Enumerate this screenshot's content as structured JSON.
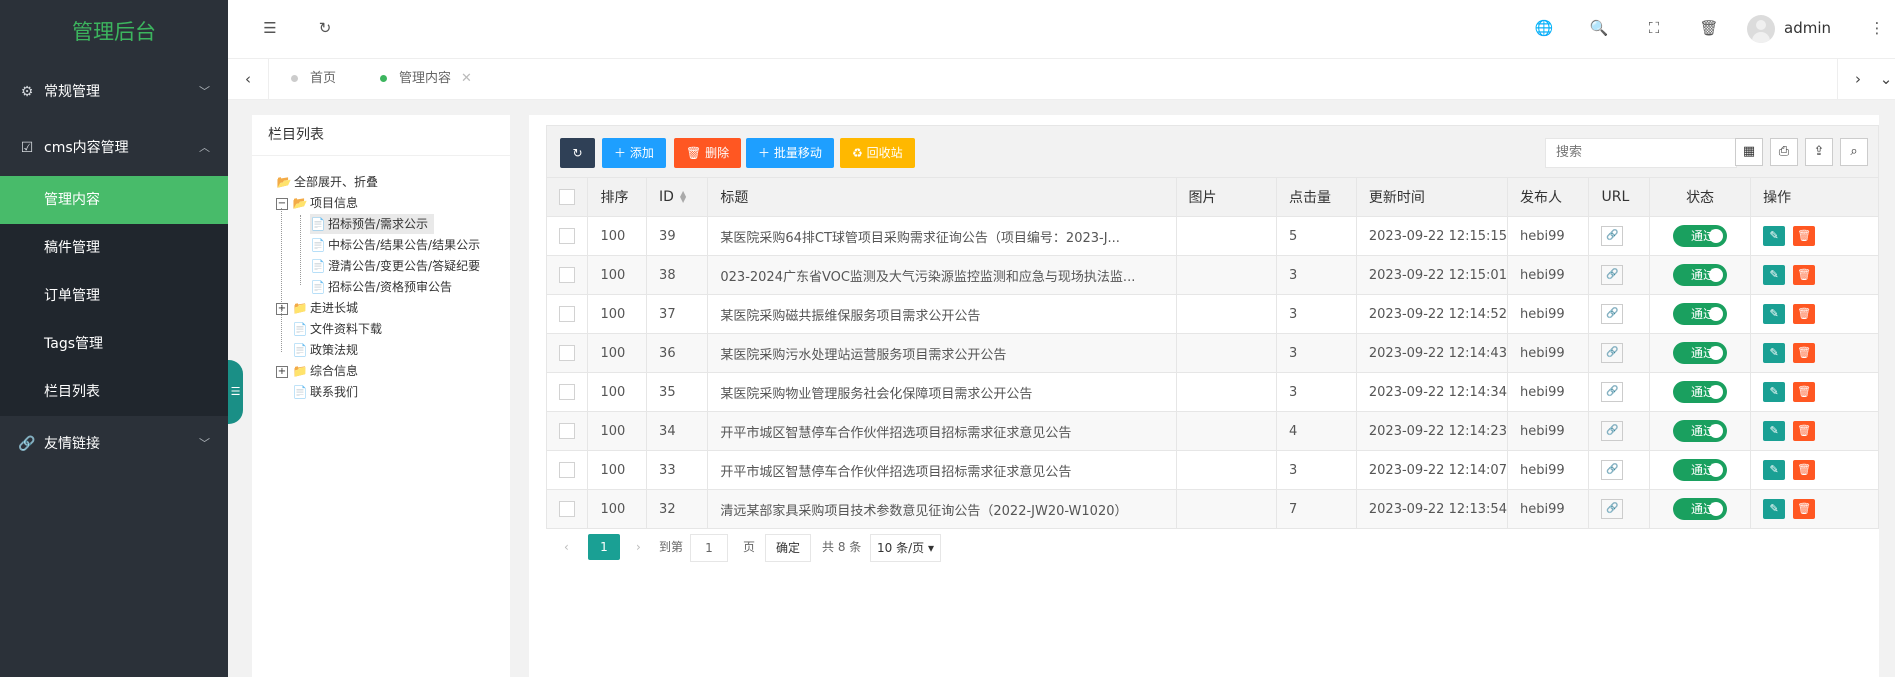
{
  "sidebar": {
    "logo": "管理后台",
    "groups": [
      {
        "label": "常规管理",
        "icon": "gear-icon"
      },
      {
        "label": "cms内容管理",
        "icon": "edit-icon"
      },
      {
        "label": "友情链接",
        "icon": "link-icon"
      }
    ],
    "subitems": [
      "管理内容",
      "稿件管理",
      "订单管理",
      "Tags管理",
      "栏目列表"
    ],
    "active_subitem": "管理内容"
  },
  "header": {
    "user": "admin",
    "icons": [
      "menu-toggle-icon",
      "refresh-icon",
      "globe-icon",
      "search-icon",
      "fullscreen-icon",
      "trash-icon",
      "more-icon"
    ]
  },
  "tabs": [
    {
      "label": "首页",
      "active": false
    },
    {
      "label": "管理内容",
      "active": true,
      "close": "✕"
    }
  ],
  "tree": {
    "title": "栏目列表",
    "expand_all": "全部展开、折叠",
    "nodes": {
      "xiangmu": "项目信息",
      "c1": "招标预告/需求公示",
      "c2": "中标公告/结果公告/结果公示",
      "c3": "澄清公告/变更公告/答疑纪要",
      "c4": "招标公告/资格预审公告",
      "zoujin": "走进长城",
      "wenjian": "文件资料下载",
      "zhengce": "政策法规",
      "zonghe": "综合信息",
      "lianxi": "联系我们"
    }
  },
  "toolbar": {
    "add": "添加",
    "delete": "删除",
    "batch_move": "批量移动",
    "recycle": "回收站",
    "search_placeholder": "搜索",
    "colors": {
      "refresh": "#2f4056",
      "add": "#1e9fff",
      "delete": "#ff5722",
      "batch": "#1e9fff",
      "recycle": "#ffb800"
    }
  },
  "table": {
    "headers": [
      "排序",
      "ID",
      "标题",
      "图片",
      "点击量",
      "更新时间",
      "发布人",
      "URL",
      "状态",
      "操作"
    ],
    "rows": [
      {
        "sort": "100",
        "id": "39",
        "title": "某医院采购64排CT球管项目采购需求征询公告（项目编号：2023-J...",
        "clicks": "5",
        "time": "2023-09-22 12:15:15",
        "author": "hebi99",
        "status": "通过"
      },
      {
        "sort": "100",
        "id": "38",
        "title": "023-2024广东省VOC监测及大气污染源监控监测和应急与现场执法监...",
        "clicks": "3",
        "time": "2023-09-22 12:15:01",
        "author": "hebi99",
        "status": "通过"
      },
      {
        "sort": "100",
        "id": "37",
        "title": "某医院采购磁共振维保服务项目需求公开公告",
        "clicks": "3",
        "time": "2023-09-22 12:14:52",
        "author": "hebi99",
        "status": "通过"
      },
      {
        "sort": "100",
        "id": "36",
        "title": "某医院采购污水处理站运营服务项目需求公开公告",
        "clicks": "3",
        "time": "2023-09-22 12:14:43",
        "author": "hebi99",
        "status": "通过"
      },
      {
        "sort": "100",
        "id": "35",
        "title": "某医院采购物业管理服务社会化保障项目需求公开公告",
        "clicks": "3",
        "time": "2023-09-22 12:14:34",
        "author": "hebi99",
        "status": "通过"
      },
      {
        "sort": "100",
        "id": "34",
        "title": "开平市城区智慧停车合作伙伴招选项目招标需求征求意见公告",
        "clicks": "4",
        "time": "2023-09-22 12:14:23",
        "author": "hebi99",
        "status": "通过"
      },
      {
        "sort": "100",
        "id": "33",
        "title": "开平市城区智慧停车合作伙伴招选项目招标需求征求意见公告",
        "clicks": "3",
        "time": "2023-09-22 12:14:07",
        "author": "hebi99",
        "status": "通过"
      },
      {
        "sort": "100",
        "id": "32",
        "title": "清远某部家具采购项目技术参数意见征询公告（2022-JW20-W1020）",
        "clicks": "7",
        "time": "2023-09-22 12:13:54",
        "author": "hebi99",
        "status": "通过"
      }
    ]
  },
  "pagination": {
    "current": "1",
    "goto_label": "到第",
    "page_input": "1",
    "page_unit": "页",
    "confirm": "确定",
    "total": "共 8 条",
    "page_size": "10 条/页"
  }
}
